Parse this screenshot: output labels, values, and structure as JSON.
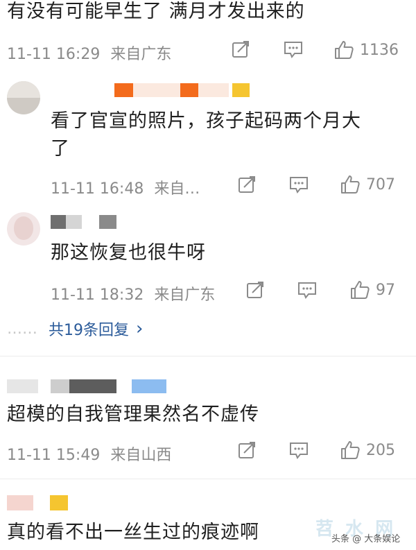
{
  "comments": [
    {
      "text": "有没有可能早生了 满月才发出来的",
      "time": "11-11 16:29",
      "location": "来自广东",
      "likes": "1136"
    },
    {
      "text_line1": "看了官宣的照片，孩子起码两个月大",
      "text_line2": "了",
      "time": "11-11 16:48",
      "location": "来自…",
      "likes": "707"
    },
    {
      "text": "那这恢复也很牛呀",
      "time": "11-11 18:32",
      "location": "来自广东",
      "likes": "97"
    },
    {
      "text": "超模的自我管理果然名不虚传",
      "time": "11-11 15:49",
      "location": "来自山西",
      "likes": "205"
    },
    {
      "text": "真的看不出一丝生过的痕迹啊"
    }
  ],
  "replies": {
    "dots": "……",
    "label": "共19条回复",
    "chevron": "›"
  },
  "watermark": {
    "main": "苕 水 网",
    "sub": "头条 @ 大条娱论"
  },
  "icons": {
    "share": "share-icon",
    "comment": "comment-icon",
    "like": "thumbs-up-icon"
  },
  "colors": {
    "accent_orange": "#f36b1c",
    "accent_yellow": "#f5c530",
    "link_blue": "#2b5b9a"
  }
}
